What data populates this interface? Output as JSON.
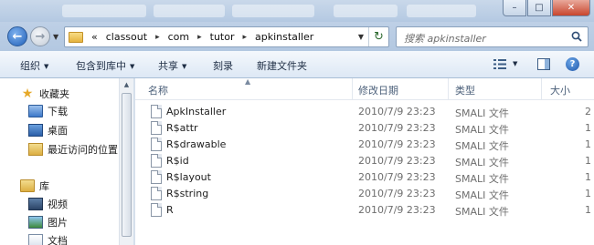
{
  "titlebar": {
    "min_label": "–",
    "max_label": "□",
    "close_label": "✕"
  },
  "address": {
    "prefix": "«",
    "segments": [
      "classout",
      "com",
      "tutor",
      "apkinstaller"
    ],
    "separator": "▸",
    "refresh_label": "↻"
  },
  "search": {
    "placeholder": "搜索 apkinstaller"
  },
  "toolbar": {
    "organize": "组织",
    "include_library": "包含到库中",
    "share": "共享",
    "burn": "刻录",
    "new_folder": "新建文件夹",
    "help_label": "?"
  },
  "nav": {
    "favorites": "收藏夹",
    "downloads": "下载",
    "desktop": "桌面",
    "recent": "最近访问的位置",
    "libraries": "库",
    "videos": "视频",
    "pictures": "图片",
    "documents": "文档"
  },
  "columns": {
    "name": "名称",
    "date": "修改日期",
    "type": "类型",
    "size": "大小"
  },
  "files": [
    {
      "name": "ApkInstaller",
      "date": "2010/7/9 23:23",
      "type": "SMALI 文件",
      "size": "2"
    },
    {
      "name": "R$attr",
      "date": "2010/7/9 23:23",
      "type": "SMALI 文件",
      "size": "1"
    },
    {
      "name": "R$drawable",
      "date": "2010/7/9 23:23",
      "type": "SMALI 文件",
      "size": "1"
    },
    {
      "name": "R$id",
      "date": "2010/7/9 23:23",
      "type": "SMALI 文件",
      "size": "1"
    },
    {
      "name": "R$layout",
      "date": "2010/7/9 23:23",
      "type": "SMALI 文件",
      "size": "1"
    },
    {
      "name": "R$string",
      "date": "2010/7/9 23:23",
      "type": "SMALI 文件",
      "size": "1"
    },
    {
      "name": "R",
      "date": "2010/7/9 23:23",
      "type": "SMALI 文件",
      "size": "1"
    }
  ]
}
